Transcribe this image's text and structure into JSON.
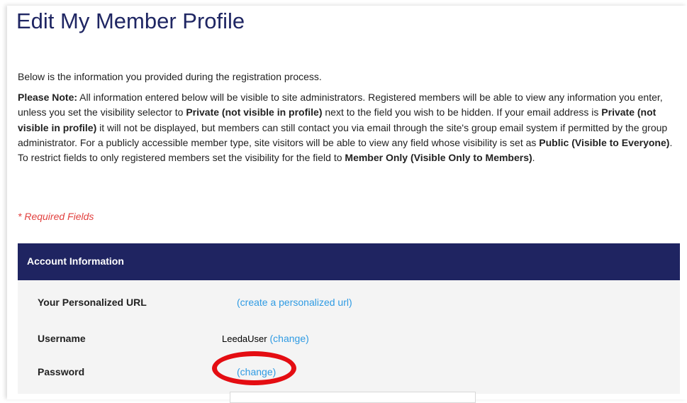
{
  "page_title": "Edit My Member Profile",
  "intro_text": "Below is the information you provided during the registration process.",
  "note": {
    "label": "Please Note:",
    "t1": " All information entered below will be visible to site administrators. Registered members will be able to view any information you enter, unless you set the visibility selector to ",
    "b1": "Private (not visible in profile)",
    "t2": " next to the field you wish to be hidden. If your email address is ",
    "b2": "Private (not visible in profile)",
    "t3": " it will not be displayed, but members can still contact you via email through the site's group email system if permitted by the group administrator. For a publicly accessible member type, site visitors will be able to view any field whose visibility is set as ",
    "b3": "Public (Visible to Everyone)",
    "t4": ". To restrict fields to only registered members set the visibility for the field to ",
    "b4": "Member Only (Visible Only to Members)",
    "t5": "."
  },
  "required_label": "* Required Fields",
  "section": {
    "title": "Account Information",
    "rows": [
      {
        "label": "Your Personalized URL",
        "link": "create a personalized url"
      },
      {
        "label": "Username",
        "value": "LeedaUser",
        "link": "change"
      },
      {
        "label": "Password",
        "link": "change"
      }
    ]
  },
  "colors": {
    "title": "#1f2663",
    "section_bar": "#1f2461",
    "link": "#2f9be3",
    "required": "#e2413f",
    "highlight_ring": "#e40d12"
  }
}
